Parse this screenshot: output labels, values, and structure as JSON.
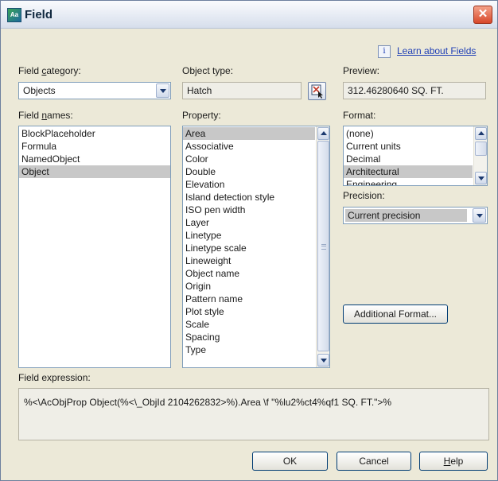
{
  "window": {
    "title": "Field",
    "icon_glyph": "Aa",
    "close_glyph": "✕",
    "learn_link": "Learn about Fields",
    "info_glyph": "i"
  },
  "field_category": {
    "label_pre": "Field ",
    "label_key": "c",
    "label_post": "ategory:",
    "value": "Objects"
  },
  "object_type": {
    "label": "Object type:",
    "value": "Hatch"
  },
  "preview": {
    "label": "Preview:",
    "value": "312.46280640 SQ. FT."
  },
  "field_names": {
    "label_pre": "Field ",
    "label_key": "n",
    "label_post": "ames:",
    "items": [
      "BlockPlaceholder",
      "Formula",
      "NamedObject",
      "Object"
    ],
    "selected": "Object"
  },
  "property": {
    "label": "Property:",
    "items": [
      "Area",
      "Associative",
      "Color",
      "Double",
      "Elevation",
      "Island detection style",
      "ISO pen width",
      "Layer",
      "Linetype",
      "Linetype scale",
      "Lineweight",
      "Object name",
      "Origin",
      "Pattern name",
      "Plot style",
      "Scale",
      "Spacing",
      "Type"
    ],
    "selected": "Area"
  },
  "format": {
    "label": "Format:",
    "items": [
      "(none)",
      "Current units",
      "Decimal",
      "Architectural",
      "Engineering"
    ],
    "selected": "Architectural"
  },
  "precision": {
    "label": "Precision:",
    "value": "Current precision"
  },
  "additional_format_button": "Additional Format...",
  "field_expression": {
    "label": "Field expression:",
    "value": "%<\\AcObjProp Object(%<\\_ObjId 2104262832>%).Area \\f \"%lu2%ct4%qf1 SQ. FT.\">%"
  },
  "buttons": {
    "ok": "OK",
    "cancel": "Cancel",
    "help_key": "H",
    "help_rest": "elp"
  }
}
